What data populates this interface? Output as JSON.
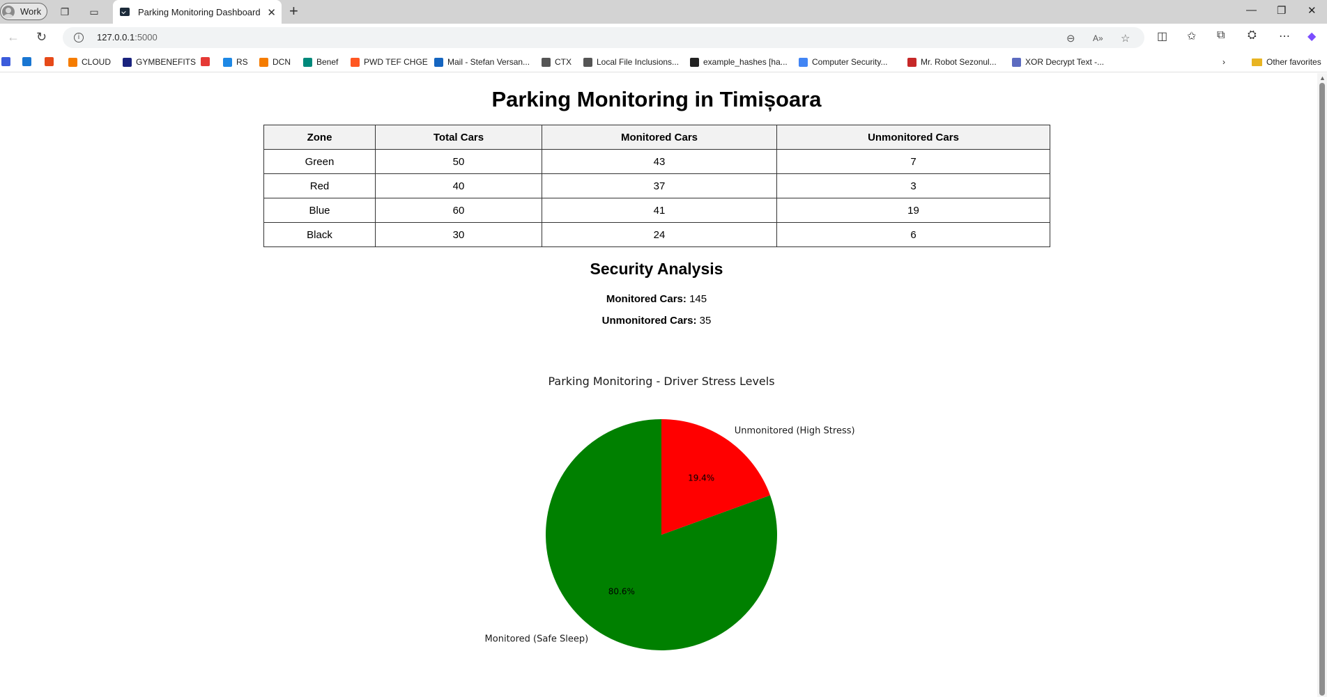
{
  "browser": {
    "profile_label": "Work",
    "tab_title": "Parking Monitoring Dashboard",
    "url_host": "127.0.0.1",
    "url_port": ":5000",
    "favorites": [
      {
        "label": "",
        "color": "#3b5bdb"
      },
      {
        "label": "",
        "color": "#1976d2"
      },
      {
        "label": "",
        "color": "#e64a19"
      },
      {
        "label": "CLOUD",
        "color": "#f57c00"
      },
      {
        "label": "GYMBENEFITS",
        "color": "#1a237e"
      },
      {
        "label": "",
        "color": "#e53935"
      },
      {
        "label": "RS",
        "color": "#1e88e5"
      },
      {
        "label": "DCN",
        "color": "#f57c00"
      },
      {
        "label": "Benef",
        "color": "#00897b"
      },
      {
        "label": "PWD TEF CHGE",
        "color": "#ff5722"
      },
      {
        "label": "Mail - Stefan Versan...",
        "color": "#1565c0"
      },
      {
        "label": "CTX",
        "color": "#555555"
      },
      {
        "label": "Local File Inclusions...",
        "color": "#555555"
      },
      {
        "label": "example_hashes [ha...",
        "color": "#222222"
      },
      {
        "label": "Computer Security...",
        "color": "#4285f4"
      },
      {
        "label": "Mr. Robot Sezonul...",
        "color": "#c62828"
      },
      {
        "label": "XOR Decrypt Text -...",
        "color": "#5c6bc0"
      }
    ],
    "other_favorites": "Other favorites"
  },
  "page": {
    "title": "Parking Monitoring in Timișoara",
    "table": {
      "headers": [
        "Zone",
        "Total Cars",
        "Monitored Cars",
        "Unmonitored Cars"
      ],
      "rows": [
        [
          "Green",
          "50",
          "43",
          "7"
        ],
        [
          "Red",
          "40",
          "37",
          "3"
        ],
        [
          "Blue",
          "60",
          "41",
          "19"
        ],
        [
          "Black",
          "30",
          "24",
          "6"
        ]
      ]
    },
    "analysis": {
      "title": "Security Analysis",
      "monitored_label": "Monitored Cars:",
      "monitored_value": "145",
      "unmonitored_label": "Unmonitored Cars:",
      "unmonitored_value": "35"
    }
  },
  "chart_data": {
    "type": "pie",
    "title": "Parking Monitoring - Driver Stress Levels",
    "slices": [
      {
        "label": "Monitored (Safe Sleep)",
        "value": 145,
        "percent": "80.6%",
        "color": "#008000"
      },
      {
        "label": "Unmonitored (High Stress)",
        "value": 35,
        "percent": "19.4%",
        "color": "#ff0000"
      }
    ],
    "start_angle_deg": 90
  }
}
